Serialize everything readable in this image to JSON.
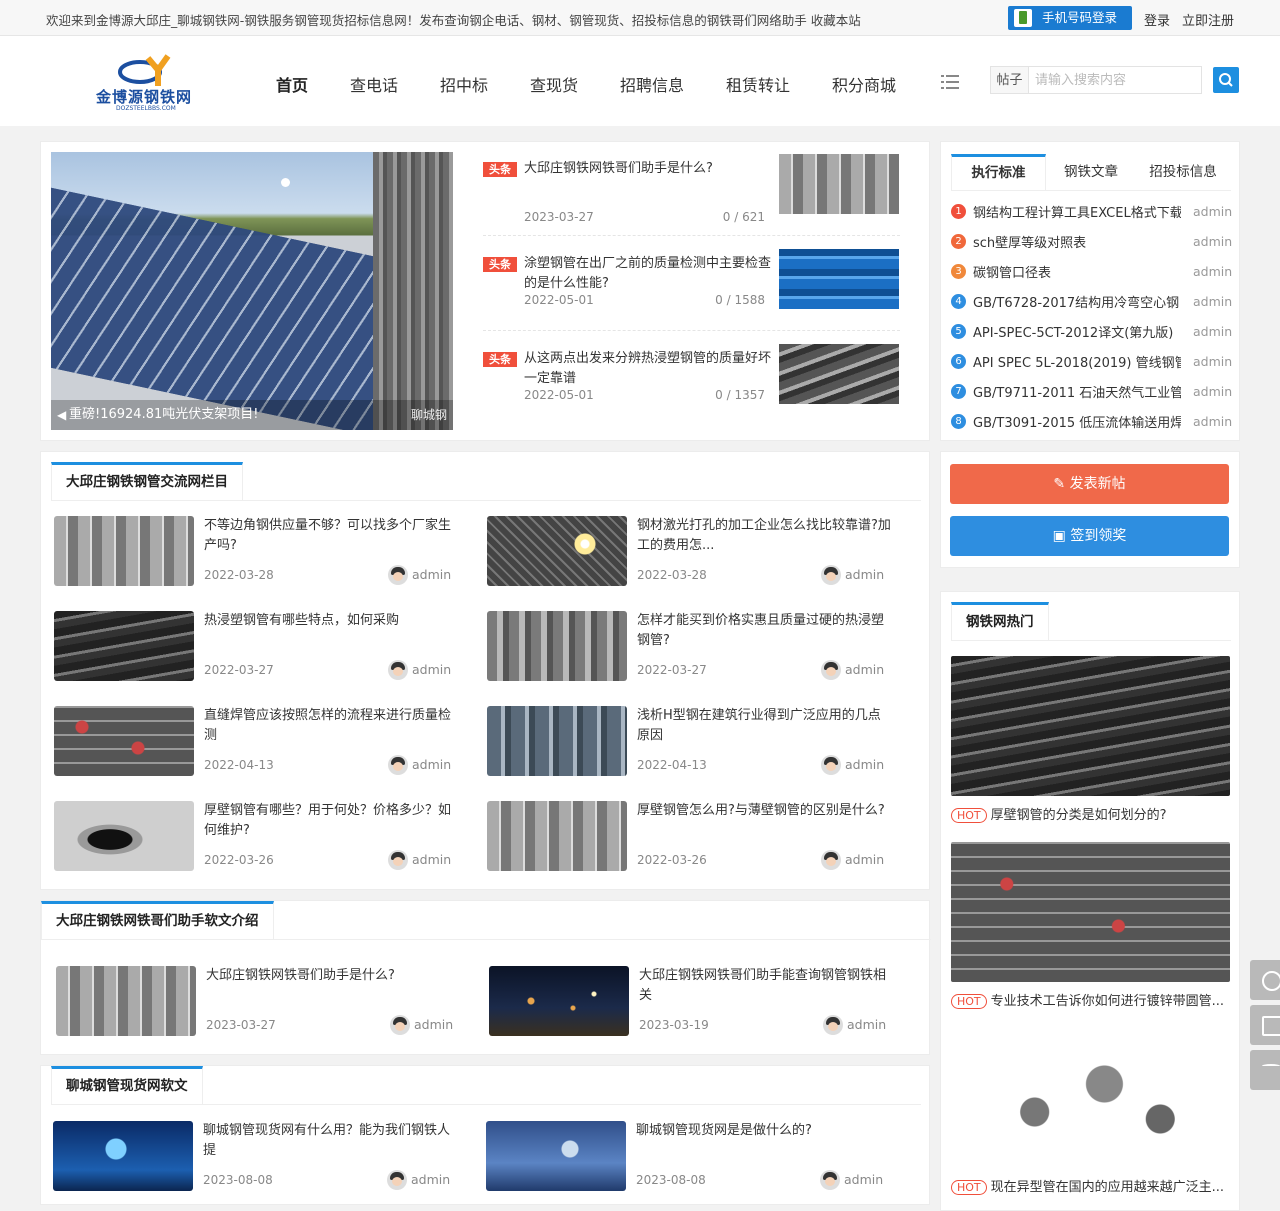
{
  "topbar": {
    "welcome": "欢迎来到金博源大邱庄_聊城钢铁网-钢铁服务钢管现货招标信息网！发布查询钢企电话、钢材、钢管现货、招投标信息的钢铁哥们网络助手   收藏本站",
    "phone_login": "手机号码登录",
    "login": "登录",
    "register": "立即注册"
  },
  "logo": {
    "brand": "金博源钢铁网",
    "sub": "DOZSTEELBBS.COM"
  },
  "nav": [
    "首页",
    "查电话",
    "招中标",
    "查现货",
    "招聘信息",
    "租赁转让",
    "积分商城"
  ],
  "search": {
    "type": "帖子",
    "placeholder": "请输入搜索内容"
  },
  "slider": {
    "caption": "重磅!16924.81吨光伏支架项目!",
    "caption2": "聊城钢"
  },
  "headlines": [
    {
      "tag": "头条",
      "title": "大邱庄钢铁网铁哥们助手是什么?",
      "date": "2023-03-27",
      "stat": "0 / 621"
    },
    {
      "tag": "头条",
      "title": "涂塑钢管在出厂之前的质量检测中主要检查的是什么性能?",
      "date": "2022-05-01",
      "stat": "0 / 1588"
    },
    {
      "tag": "头条",
      "title": "从这两点出发来分辨热浸塑钢管的质量好坏一定靠谱",
      "date": "2022-05-01",
      "stat": "0 / 1357"
    }
  ],
  "std_tabs": [
    "执行标准",
    "钢铁文章",
    "招投标信息"
  ],
  "standards": [
    {
      "n": "1",
      "t": "钢结构工程计算工具EXCEL格式下载",
      "a": "admin",
      "c": "#f04f3b"
    },
    {
      "n": "2",
      "t": "sch壁厚等级对照表",
      "a": "admin",
      "c": "#f0683b"
    },
    {
      "n": "3",
      "t": "碳钢管口径表",
      "a": "admin",
      "c": "#f0883b"
    },
    {
      "n": "4",
      "t": "GB/T6728-2017结构用冷弯空心钢",
      "a": "admin",
      "c": "#2e8ee0"
    },
    {
      "n": "5",
      "t": "API-SPEC-5CT-2012译文(第九版)",
      "a": "admin",
      "c": "#2e8ee0"
    },
    {
      "n": "6",
      "t": "API SPEC 5L-2018(2019) 管线钢管",
      "a": "admin",
      "c": "#2e8ee0"
    },
    {
      "n": "7",
      "t": "GB/T9711-2011 石油天然气工业管",
      "a": "admin",
      "c": "#2e8ee0"
    },
    {
      "n": "8",
      "t": "GB/T3091-2015 低压流体输送用焊",
      "a": "admin",
      "c": "#2e8ee0"
    }
  ],
  "sec1": {
    "title": "大邱庄钢铁钢管交流网栏目",
    "articles": [
      {
        "t": "不等边角钢供应量不够？可以找多个厂家生产吗?",
        "d": "2022-03-28",
        "u": "admin"
      },
      {
        "t": "钢材激光打孔的加工企业怎么找比较靠谱?加工的费用怎...",
        "d": "2022-03-28",
        "u": "admin"
      },
      {
        "t": "热浸塑钢管有哪些特点，如何采购",
        "d": "2022-03-27",
        "u": "admin"
      },
      {
        "t": "怎样才能买到价格实惠且质量过硬的热浸塑钢管?",
        "d": "2022-03-27",
        "u": "admin"
      },
      {
        "t": "直缝焊管应该按照怎样的流程来进行质量检测",
        "d": "2022-04-13",
        "u": "admin"
      },
      {
        "t": "浅析H型钢在建筑行业得到广泛应用的几点原因",
        "d": "2022-04-13",
        "u": "admin"
      },
      {
        "t": "厚壁钢管有哪些？用于何处？价格多少？如何维护?",
        "d": "2022-03-26",
        "u": "admin"
      },
      {
        "t": "厚壁钢管怎么用?与薄壁钢管的区别是什么?",
        "d": "2022-03-26",
        "u": "admin"
      }
    ]
  },
  "sec2": {
    "title": "大邱庄钢铁网铁哥们助手软文介绍",
    "articles": [
      {
        "t": "大邱庄钢铁网铁哥们助手是什么?",
        "d": "2023-03-27",
        "u": "admin"
      },
      {
        "t": "大邱庄钢铁网铁哥们助手能查询钢管钢铁相关",
        "d": "2023-03-19",
        "u": "admin"
      }
    ]
  },
  "sec3": {
    "title": "聊城钢管现货网软文",
    "articles": [
      {
        "t": "聊城钢管现货网有什么用？能为我们钢铁人提",
        "d": "2023-08-08",
        "u": "admin"
      },
      {
        "t": "聊城钢管现货网是是做什么的?",
        "d": "2023-08-08",
        "u": "admin"
      }
    ]
  },
  "side": {
    "post": "发表新帖",
    "sign": "签到领奖",
    "hot_title": "钢铁网热门",
    "hot_tag": "HOT",
    "hot": [
      "厚壁钢管的分类是如何划分的?",
      "专业技术工告诉你如何进行镀锌带圆管...",
      "现在异型管在国内的应用越来越广泛主..."
    ]
  }
}
